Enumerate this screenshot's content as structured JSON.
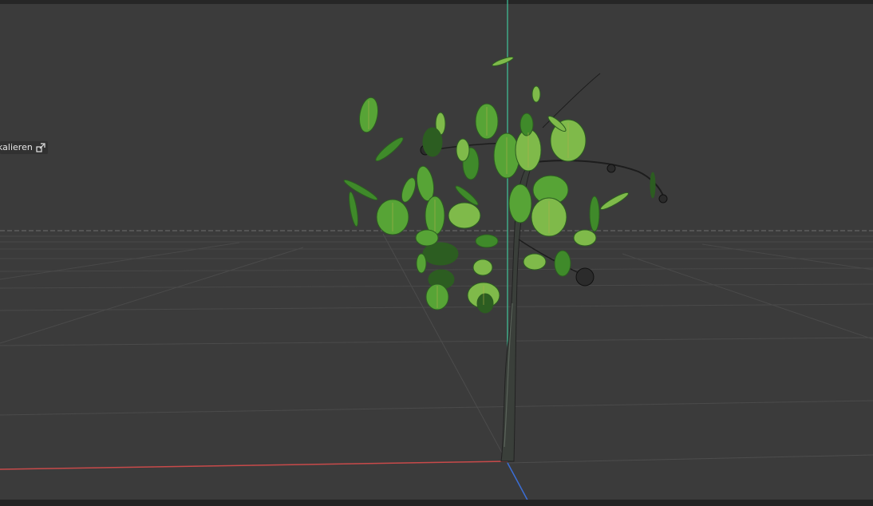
{
  "tool_chip": {
    "label": "kalieren",
    "icon": "scale-icon"
  },
  "viewport": {
    "background": "#3b3b3b",
    "axis_colors": {
      "x": "#d04848",
      "y": "#3fc49a",
      "z": "#3b6ed6"
    },
    "leaf_colors": [
      "#3f8a2a",
      "#57a436",
      "#2c5d21",
      "#7fba4a"
    ],
    "object": "tree-model"
  }
}
